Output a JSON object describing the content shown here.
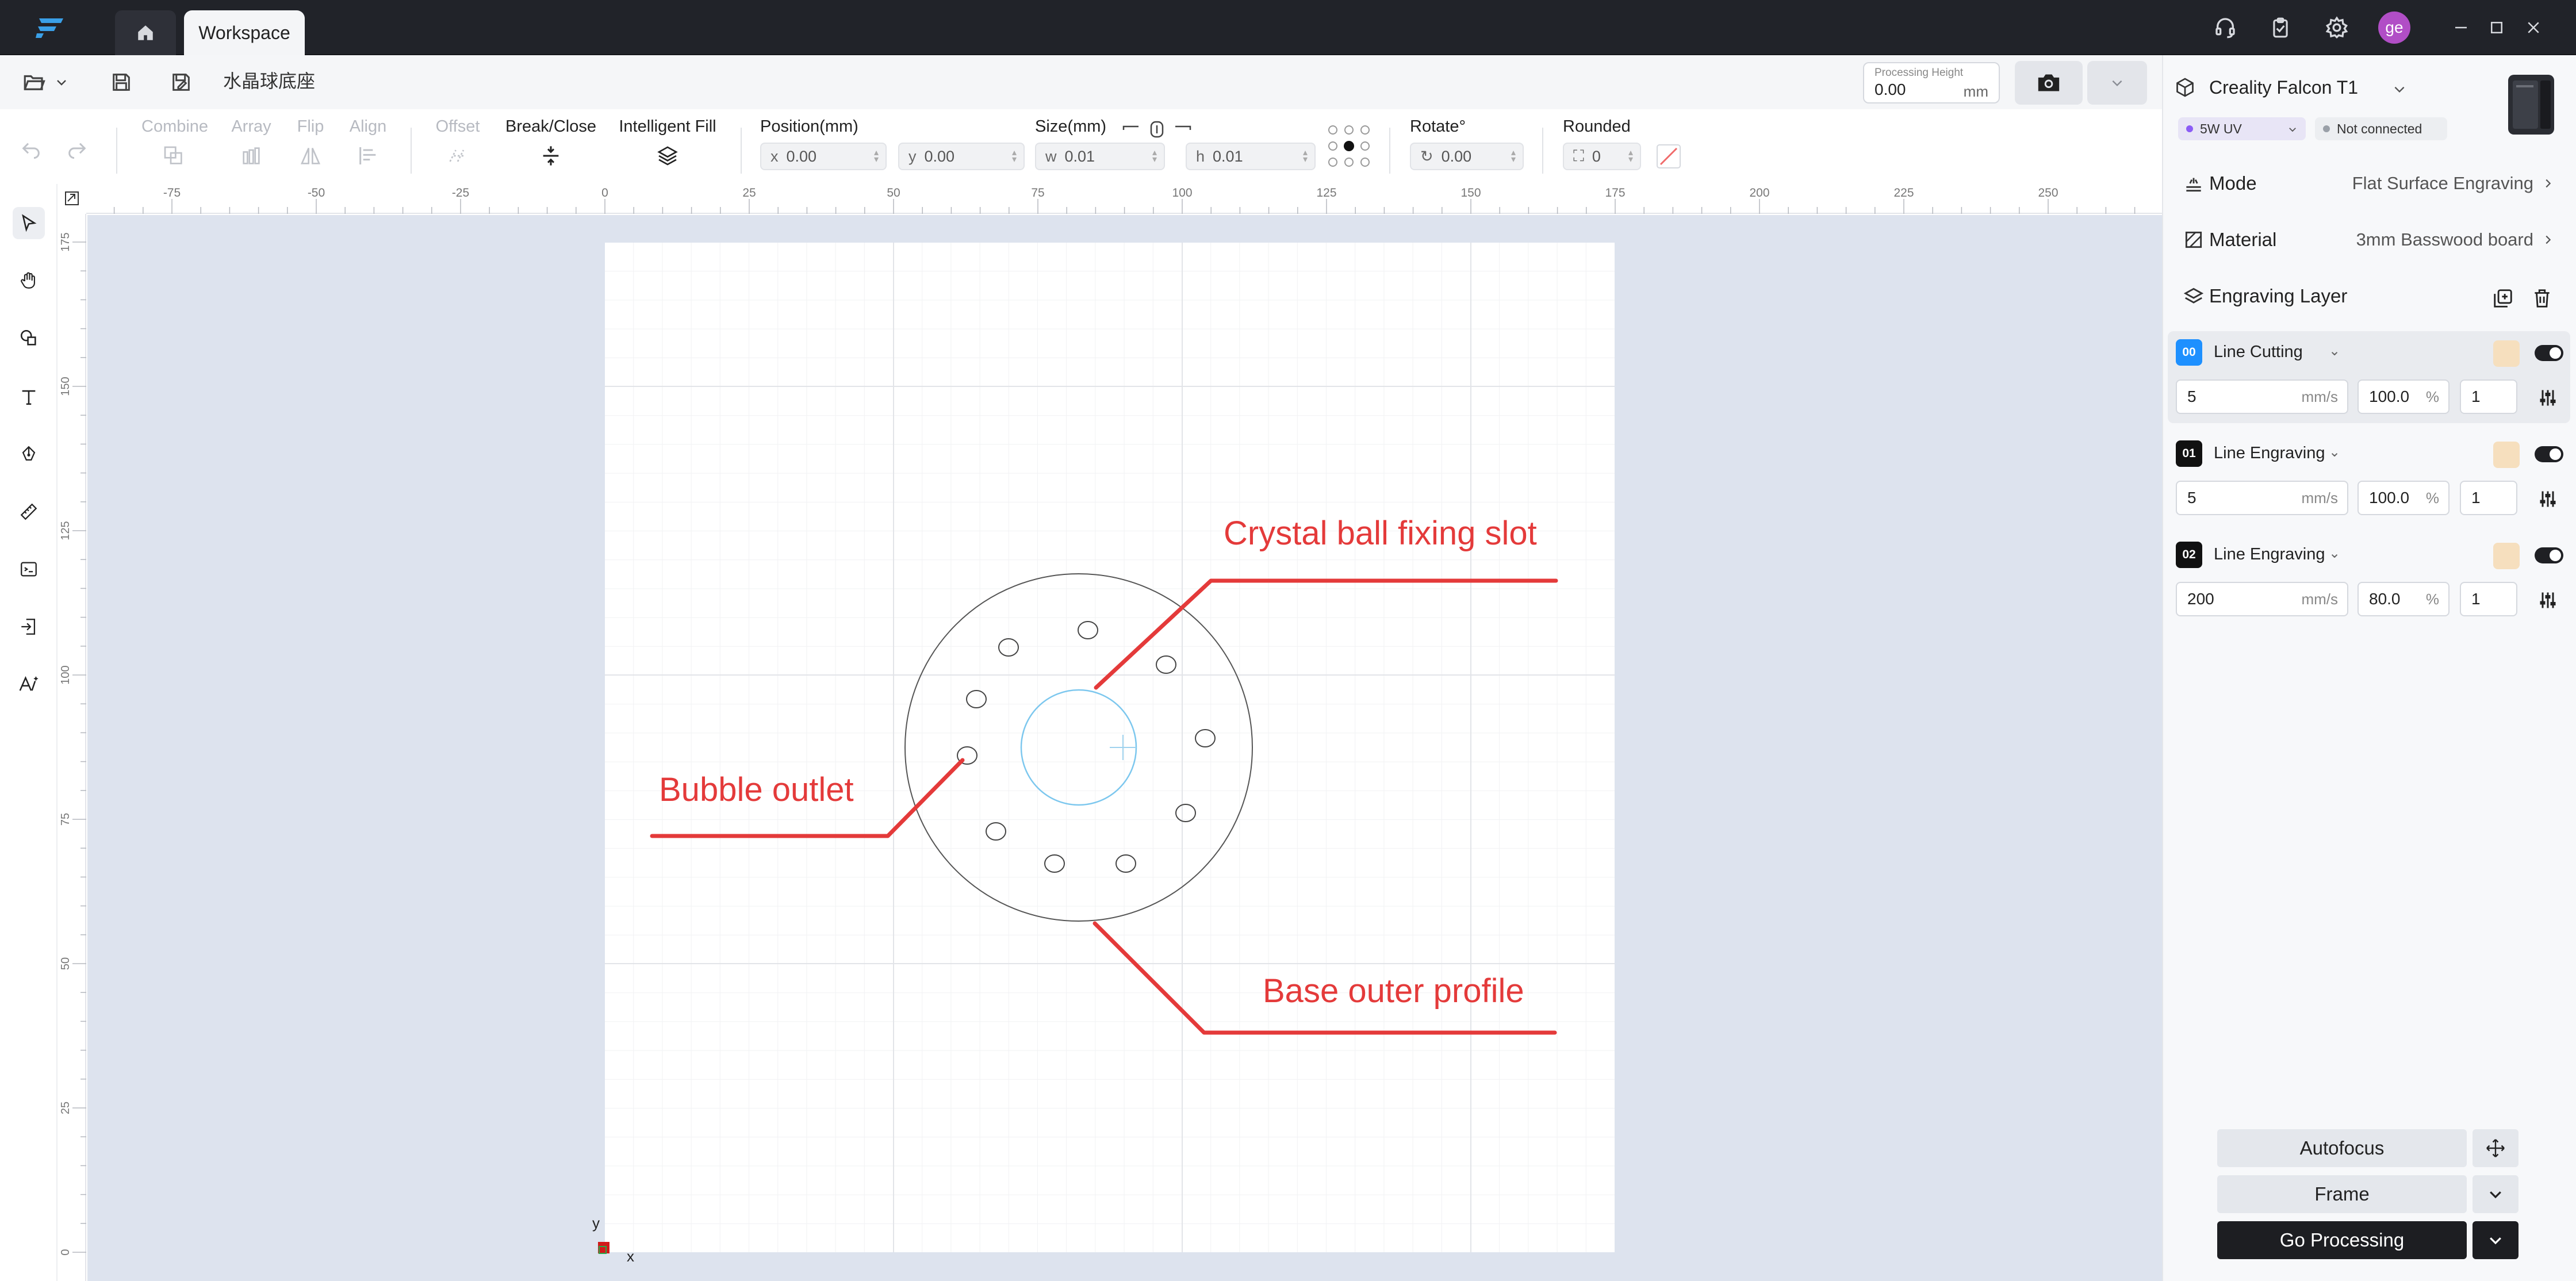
{
  "titlebar": {
    "tab_label": "Workspace",
    "avatar_initials": "ge",
    "icons": [
      "app-logo",
      "home-icon",
      "support-icon",
      "clipboard-icon",
      "settings-icon",
      "minimize-icon",
      "maximize-icon",
      "close-icon"
    ]
  },
  "filebar": {
    "file_name": "水晶球底座",
    "processing_height": {
      "label": "Processing Height",
      "value": "0.00",
      "unit": "mm"
    }
  },
  "toolbar": {
    "combine": "Combine",
    "array": "Array",
    "flip": "Flip",
    "align": "Align",
    "offset": "Offset",
    "break_close": "Break/Close",
    "intelligent_fill": "Intelligent Fill",
    "position_label": "Position(mm)",
    "x_prefix": "x",
    "x_value": "0.00",
    "y_prefix": "y",
    "y_value": "0.00",
    "size_label": "Size(mm)",
    "w_prefix": "w",
    "w_value": "0.01",
    "h_prefix": "h",
    "h_value": "0.01",
    "rotate_label": "Rotate°",
    "rotate_value": "0.00",
    "rounded_label": "Rounded",
    "rounded_value": "0"
  },
  "ruler": {
    "top_ticks": [
      "-75",
      "-50",
      "-25",
      "0",
      "25",
      "50",
      "75",
      "100",
      "125",
      "150",
      "175",
      "200",
      "225",
      "250"
    ],
    "left_ticks": [
      "175",
      "150",
      "125",
      "100",
      "75",
      "50",
      "25",
      "0"
    ]
  },
  "canvas": {
    "origin_y": "y",
    "origin_x": "x",
    "annotations": {
      "crystal": "Crystal ball fixing slot",
      "bubble": "Bubble outlet",
      "base": "Base outer profile"
    }
  },
  "device": {
    "name": "Creality Falcon T1",
    "laser": "5W UV",
    "status": "Not connected",
    "mode_label": "Mode",
    "mode_value": "Flat Surface Engraving",
    "material_label": "Material",
    "material_value": "3mm Basswood board",
    "layers_title": "Engraving Layer"
  },
  "layers": [
    {
      "num": "00",
      "name": "Line Cutting",
      "color": "#1e90ff",
      "speed": "5",
      "speed_unit": "mm/s",
      "power": "100.0",
      "power_unit": "%",
      "passes": "1"
    },
    {
      "num": "01",
      "name": "Line Engraving",
      "color": "#111111",
      "speed": "5",
      "speed_unit": "mm/s",
      "power": "100.0",
      "power_unit": "%",
      "passes": "1"
    },
    {
      "num": "02",
      "name": "Line Engraving",
      "color": "#111111",
      "speed": "200",
      "speed_unit": "mm/s",
      "power": "80.0",
      "power_unit": "%",
      "passes": "1"
    }
  ],
  "actions": {
    "autofocus": "Autofocus",
    "frame": "Frame",
    "go_processing": "Go Processing"
  },
  "colors": {
    "accent_red": "#e43a3a",
    "canvas_bg": "#dde3ee",
    "layer_cutting": "#1e90ff",
    "inner_circle": "#7cc7ee"
  }
}
